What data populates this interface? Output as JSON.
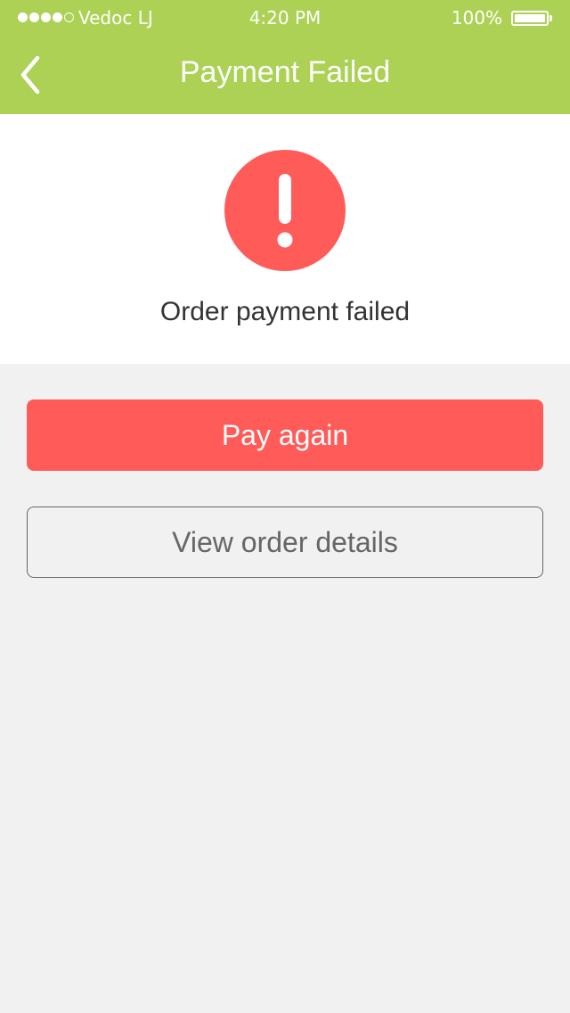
{
  "status_bar": {
    "carrier": "Vedoc LJ",
    "time": "4:20 PM",
    "battery": "100%",
    "signal_bars_filled": 4,
    "signal_bars_total": 5
  },
  "header": {
    "title": "Payment Failed",
    "back_icon": "chevron-left-icon"
  },
  "result": {
    "icon": "exclamation-circle-icon",
    "message": "Order payment failed"
  },
  "actions": {
    "pay_again_label": "Pay again",
    "view_details_label": "View order details"
  },
  "colors": {
    "header_bg": "#acd155",
    "alert": "#ff5b58",
    "page_bg": "#f1f1f1"
  }
}
